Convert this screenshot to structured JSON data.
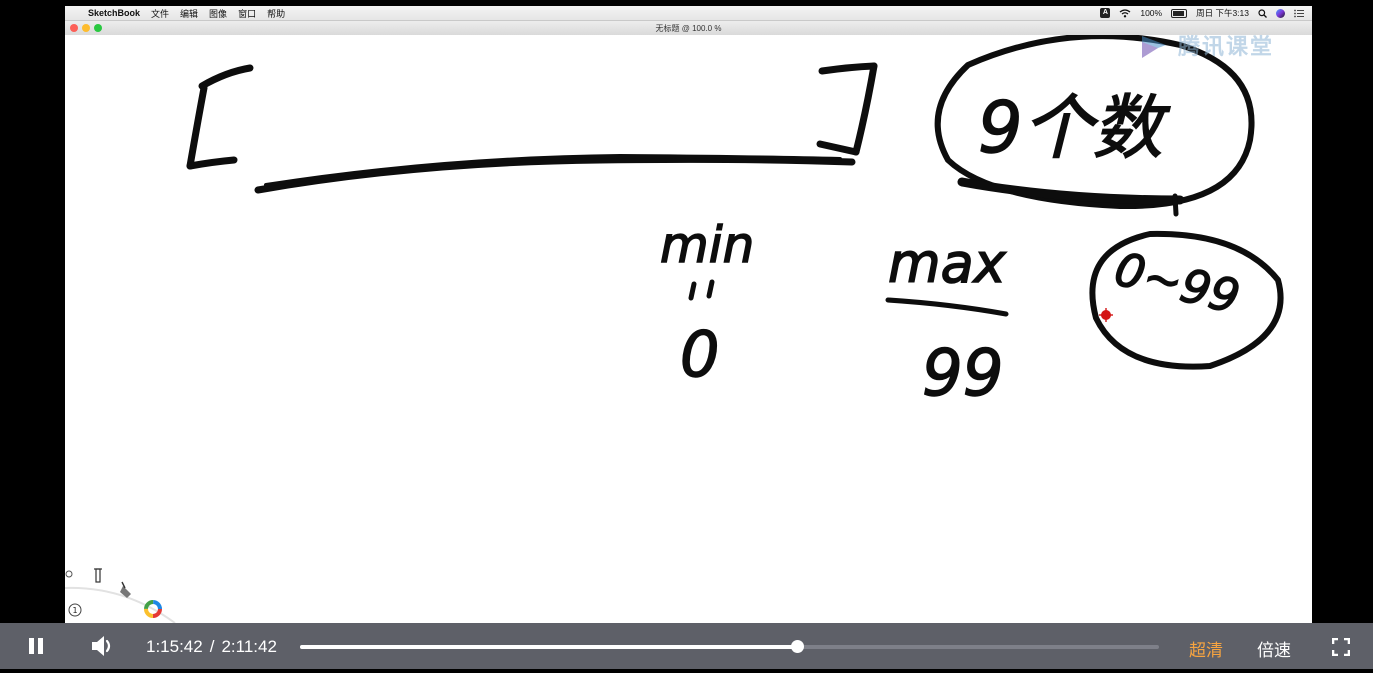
{
  "menubar": {
    "app_name": "SketchBook",
    "menus": [
      "文件",
      "编辑",
      "图像",
      "窗口",
      "帮助"
    ],
    "input_badge": "A",
    "battery": "100%",
    "datetime": "周日 下午3:13"
  },
  "window": {
    "title": "无标题 @ 100.0 %"
  },
  "watermark": {
    "text": "腾讯课堂"
  },
  "handwriting": {
    "min_label": "min",
    "min_value": "0",
    "max_label": "max",
    "max_value": "99",
    "count_label": "9个数",
    "range_label": "0~99"
  },
  "player": {
    "current_time": "1:15:42",
    "separator": "/",
    "total_time": "2:11:42",
    "progress": 0.578,
    "quality_label": "超清",
    "speed_label": "倍速",
    "accent_color": "#f7a440"
  }
}
